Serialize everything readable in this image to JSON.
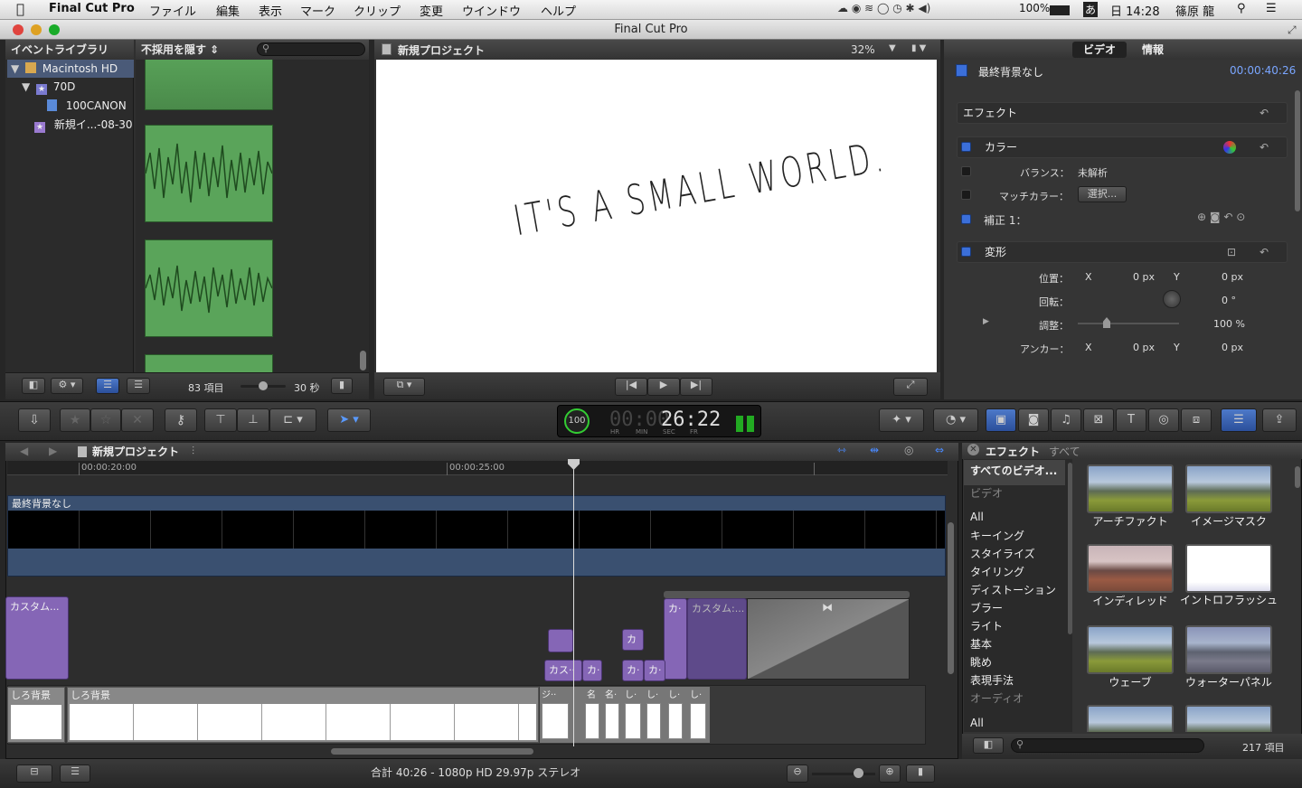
{
  "menubar": {
    "app_name": "Final Cut Pro",
    "items": [
      "ファイル",
      "編集",
      "表示",
      "マーク",
      "クリップ",
      "変更",
      "ウインドウ",
      "ヘルプ"
    ],
    "battery": "100%",
    "ime": "あ",
    "clock": "日 14:28",
    "user": "篠原 龍"
  },
  "window": {
    "title": "Final Cut Pro"
  },
  "library": {
    "header": "イベントライブラリ",
    "filter_label": "不採用を隠す ⇕",
    "items": [
      {
        "label": "Macintosh HD"
      },
      {
        "label": "70D"
      },
      {
        "label": "100CANON"
      },
      {
        "label": "新規イ...-08-30"
      }
    ],
    "item_count": "83 項目",
    "duration": "30 秒"
  },
  "viewer": {
    "title": "新規プロジェクト",
    "zoom": "32%",
    "frame_text": "IT'S A SMALL WORLD."
  },
  "inspector": {
    "tabs": [
      "ビデオ",
      "情報"
    ],
    "clip_name": "最終背景なし",
    "timecode": "00:00:40:26",
    "effects": "エフェクト",
    "color": "カラー",
    "balance_label": "バランス：",
    "balance_value": "未解析",
    "match_label": "マッチカラー：",
    "match_button": "選択...",
    "correction": "補正 1：",
    "transform": "変形",
    "position_label": "位置：",
    "x_label": "X",
    "y_label": "Y",
    "pos_x": "0 px",
    "pos_y": "0 px",
    "rotation_label": "回転：",
    "rotation_value": "0 °",
    "scale_label": "調整：",
    "scale_value": "100 %",
    "anchor_label": "アンカー：",
    "anchor_x": "0 px",
    "anchor_y": "0 px"
  },
  "toolbar": {
    "timecode_pct": "100",
    "timecode_dim": "00:00",
    "timecode_main": "26:22",
    "tc_units": [
      "HR",
      "MIN",
      "SEC",
      "FR"
    ]
  },
  "timeline": {
    "project": "新規プロジェクト",
    "ruler": [
      "00:00:20:00",
      "00:00:25:00"
    ],
    "top_clip": "最終背景なし",
    "clips": {
      "custom1": "カスタム...",
      "custom2": "カスタム:...",
      "ka1": "カ·",
      "ka_small": "カ",
      "kas": "カス··",
      "ka2": "カ·",
      "ka3": "カ·",
      "ka4": "カ·",
      "shiro1": "しろ背景",
      "shiro2": "しろ背景",
      "small_labels": [
        "ジ··",
        "名",
        "名·",
        "し·",
        "し·",
        "し·",
        "し·"
      ]
    }
  },
  "effects_browser": {
    "title": "エフェクト",
    "scope": "すべて",
    "categories": [
      {
        "label": "すべてのビデオ...",
        "dim": false
      },
      {
        "label": "ビデオ",
        "dim": true
      },
      {
        "label": "All",
        "dim": false
      },
      {
        "label": "キーイング",
        "dim": false
      },
      {
        "label": "スタイライズ",
        "dim": false
      },
      {
        "label": "タイリング",
        "dim": false
      },
      {
        "label": "ディストーション",
        "dim": false
      },
      {
        "label": "ブラー",
        "dim": false
      },
      {
        "label": "ライト",
        "dim": false
      },
      {
        "label": "基本",
        "dim": false
      },
      {
        "label": "眺め",
        "dim": false
      },
      {
        "label": "表現手法",
        "dim": false
      },
      {
        "label": "オーディオ",
        "dim": true
      },
      {
        "label": "All",
        "dim": false
      }
    ],
    "thumbs": [
      "アーチファクト",
      "イメージマスク",
      "インディレッド",
      "イントロフラッシュ",
      "ウェーブ",
      "ウォーターパネル"
    ],
    "count": "217 項目"
  },
  "status": {
    "text": "合計 40:26 - 1080p HD 29.97p ステレオ"
  }
}
